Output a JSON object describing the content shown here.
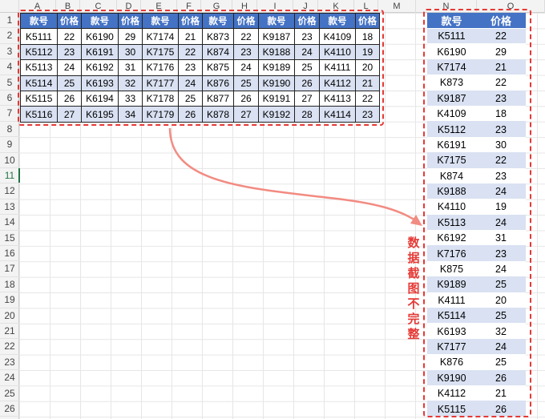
{
  "columns": [
    "A",
    "B",
    "C",
    "D",
    "E",
    "F",
    "G",
    "H",
    "I",
    "J",
    "K",
    "L",
    "M",
    "N",
    "O"
  ],
  "rows": [
    "1",
    "2",
    "3",
    "4",
    "5",
    "6",
    "7",
    "8",
    "9",
    "10",
    "11",
    "12",
    "13",
    "14",
    "15",
    "16",
    "17",
    "18",
    "19",
    "20",
    "21",
    "22",
    "23",
    "24",
    "25",
    "26"
  ],
  "active_row": "11",
  "left_table": {
    "headers": [
      "款号",
      "价格",
      "款号",
      "价格",
      "款号",
      "价格",
      "款号",
      "价格",
      "款号",
      "价格",
      "款号",
      "价格"
    ],
    "rows": [
      [
        "K5111",
        "22",
        "K6190",
        "29",
        "K7174",
        "21",
        "K873",
        "22",
        "K9187",
        "23",
        "K4109",
        "18"
      ],
      [
        "K5112",
        "23",
        "K6191",
        "30",
        "K7175",
        "22",
        "K874",
        "23",
        "K9188",
        "24",
        "K4110",
        "19"
      ],
      [
        "K5113",
        "24",
        "K6192",
        "31",
        "K7176",
        "23",
        "K875",
        "24",
        "K9189",
        "25",
        "K4111",
        "20"
      ],
      [
        "K5114",
        "25",
        "K6193",
        "32",
        "K7177",
        "24",
        "K876",
        "25",
        "K9190",
        "26",
        "K4112",
        "21"
      ],
      [
        "K5115",
        "26",
        "K6194",
        "33",
        "K7178",
        "25",
        "K877",
        "26",
        "K9191",
        "27",
        "K4113",
        "22"
      ],
      [
        "K5116",
        "27",
        "K6195",
        "34",
        "K7179",
        "26",
        "K878",
        "27",
        "K9192",
        "28",
        "K4114",
        "23"
      ]
    ]
  },
  "right_table": {
    "headers": [
      "款号",
      "价格"
    ],
    "rows": [
      [
        "K5111",
        "22"
      ],
      [
        "K6190",
        "29"
      ],
      [
        "K7174",
        "21"
      ],
      [
        "K873",
        "22"
      ],
      [
        "K9187",
        "23"
      ],
      [
        "K4109",
        "18"
      ],
      [
        "K5112",
        "23"
      ],
      [
        "K6191",
        "30"
      ],
      [
        "K7175",
        "22"
      ],
      [
        "K874",
        "23"
      ],
      [
        "K9188",
        "24"
      ],
      [
        "K4110",
        "19"
      ],
      [
        "K5113",
        "24"
      ],
      [
        "K6192",
        "31"
      ],
      [
        "K7176",
        "23"
      ],
      [
        "K875",
        "24"
      ],
      [
        "K9189",
        "25"
      ],
      [
        "K4111",
        "20"
      ],
      [
        "K5114",
        "25"
      ],
      [
        "K6193",
        "32"
      ],
      [
        "K7177",
        "24"
      ],
      [
        "K876",
        "25"
      ],
      [
        "K9190",
        "26"
      ],
      [
        "K4112",
        "21"
      ],
      [
        "K5115",
        "26"
      ]
    ]
  },
  "annotation": [
    "数",
    "据",
    "截",
    "图",
    "不",
    "完",
    "整"
  ],
  "colors": {
    "header_blue": "#4472c4",
    "band_blue": "#d9e1f2",
    "annotation_red": "#e53935",
    "active_green": "#217346"
  }
}
